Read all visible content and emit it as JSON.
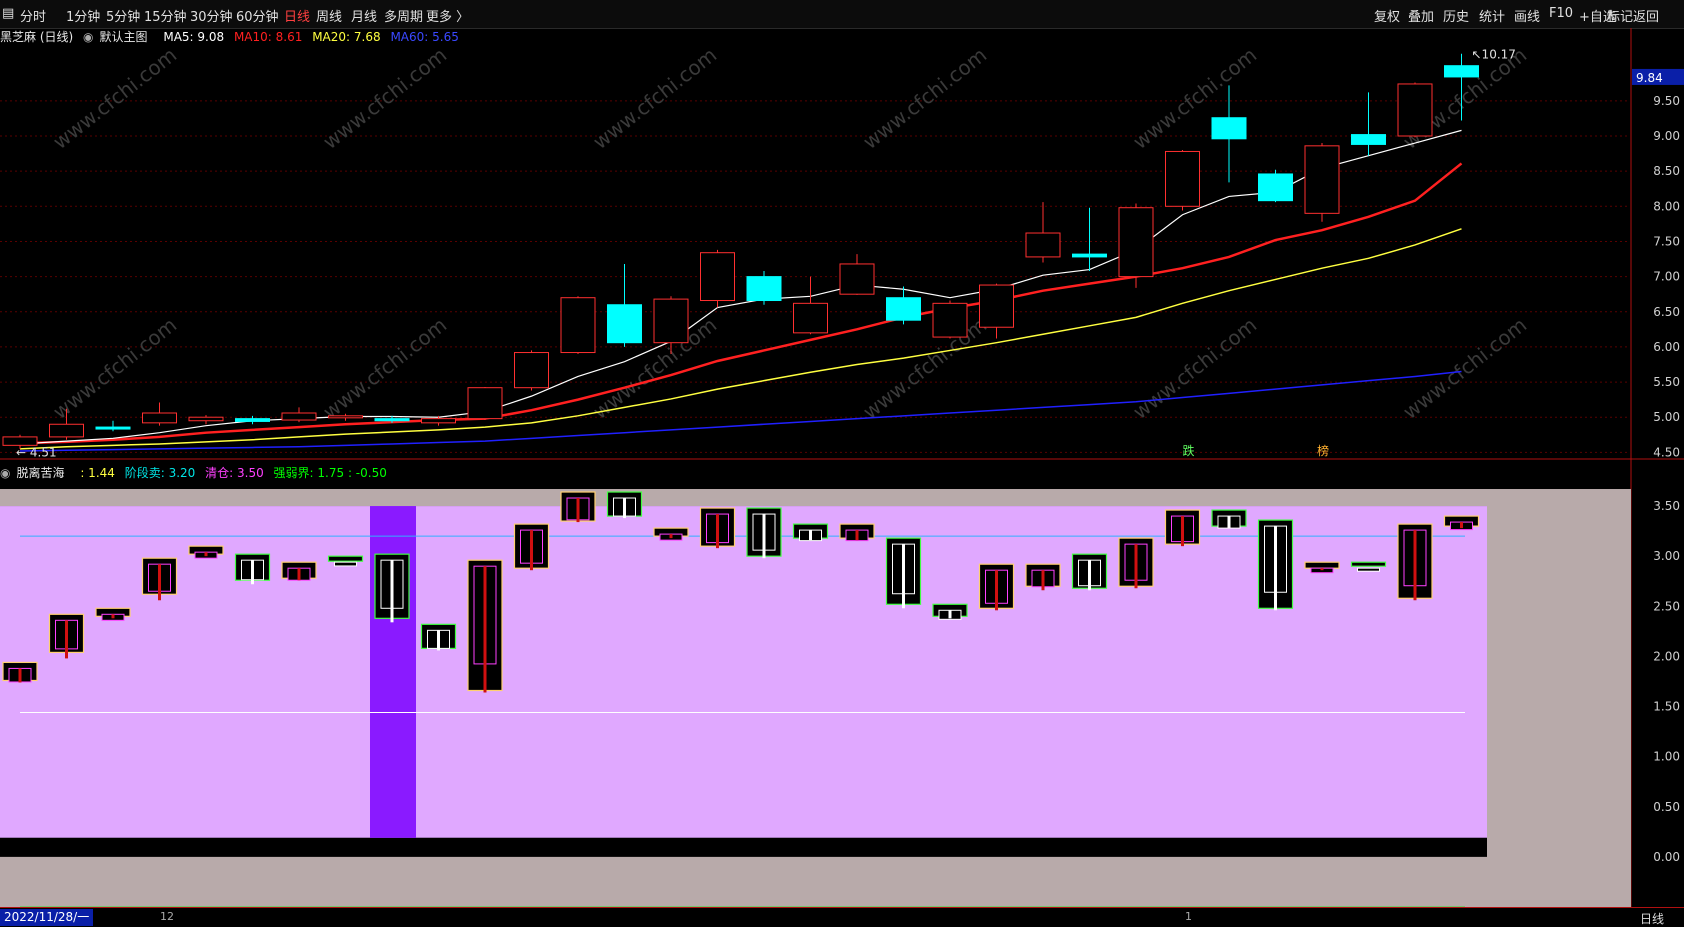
{
  "toolbar": {
    "left": [
      "分时",
      "1分钟",
      "5分钟",
      "15分钟",
      "30分钟",
      "60分钟",
      "日线",
      "周线",
      "月线",
      "多周期",
      "更多 〉"
    ],
    "active": "日线",
    "right": [
      "复权",
      "叠加",
      "历史",
      "统计",
      "画线",
      "F10",
      "+自选",
      "返回"
    ]
  },
  "main_header": {
    "stock": "黑芝麻 (日线)",
    "template": "默认主图",
    "ma5": "MA5: 9.08",
    "ma10": "MA10: 8.61",
    "ma20": "MA20: 7.68",
    "ma60": "MA60: 5.65"
  },
  "sub_header": {
    "name": "脱离苦海",
    "v1": ": 1.44",
    "v2": "阶段卖: 3.20",
    "v3": "清仓: 3.50",
    "v4": "强弱界: 1.75 : -0.50"
  },
  "markers": {
    "max_label": "10.17",
    "min_label": "4.51",
    "current_price": "9.84",
    "tag1": "跌",
    "tag2": "榜"
  },
  "status": {
    "date": "2022/11/28/一",
    "month1": "12",
    "month2": "1",
    "period": "日线"
  },
  "colors": {
    "up": "#ff3030",
    "down": "#00ffff",
    "ma5": "#ffffff",
    "ma10": "#ff2020",
    "ma20": "#ffff40",
    "ma60": "#2020ff",
    "sub_bg": "#e0a8ff",
    "sub_band": "#b8aaaa"
  },
  "watermark": "www.cfchi.com",
  "chart_data": {
    "type": "candlestick",
    "price_axis": [
      4.5,
      5.0,
      5.5,
      6.0,
      6.5,
      7.0,
      7.5,
      8.0,
      8.5,
      9.0,
      9.5
    ],
    "ind_axis": [
      0.0,
      0.5,
      1.0,
      1.5,
      2.0,
      2.5,
      3.0,
      3.5
    ],
    "candles": [
      [
        4.6,
        4.72,
        4.75,
        4.55
      ],
      [
        4.72,
        4.9,
        5.12,
        4.68
      ],
      [
        4.86,
        4.84,
        4.95,
        4.8
      ],
      [
        4.92,
        5.06,
        5.21,
        4.88
      ],
      [
        4.95,
        5.0,
        5.03,
        4.9
      ],
      [
        4.98,
        4.94,
        5.02,
        4.9
      ],
      [
        4.96,
        5.06,
        5.14,
        4.93
      ],
      [
        5.0,
        5.02,
        5.05,
        4.95
      ],
      [
        4.98,
        4.95,
        5.02,
        4.92
      ],
      [
        4.92,
        4.98,
        5.02,
        4.88
      ],
      [
        4.98,
        5.42,
        5.43,
        4.96
      ],
      [
        5.42,
        5.92,
        5.95,
        5.38
      ],
      [
        5.92,
        6.7,
        6.72,
        5.9
      ],
      [
        6.6,
        6.06,
        7.18,
        6.0
      ],
      [
        6.06,
        6.68,
        6.72,
        5.9
      ],
      [
        6.66,
        7.34,
        7.38,
        6.56
      ],
      [
        7.0,
        6.66,
        7.08,
        6.6
      ],
      [
        6.2,
        6.62,
        7.0,
        6.18
      ],
      [
        6.75,
        7.18,
        7.32,
        6.74
      ],
      [
        6.7,
        6.38,
        6.86,
        6.32
      ],
      [
        6.14,
        6.62,
        6.66,
        6.12
      ],
      [
        6.28,
        6.88,
        6.9,
        6.12
      ],
      [
        7.28,
        7.62,
        8.06,
        7.2
      ],
      [
        7.32,
        7.28,
        7.98,
        7.08
      ],
      [
        7.0,
        7.98,
        8.04,
        6.84
      ],
      [
        8.0,
        8.78,
        8.8,
        7.94
      ],
      [
        9.26,
        8.96,
        9.72,
        8.34
      ],
      [
        8.46,
        8.08,
        8.52,
        8.06
      ],
      [
        7.9,
        8.86,
        8.9,
        7.78
      ],
      [
        9.02,
        8.88,
        9.62,
        8.72
      ],
      [
        9.0,
        9.74,
        9.76,
        8.98
      ],
      [
        10.0,
        9.84,
        10.17,
        9.22
      ]
    ],
    "ma5": [
      4.62,
      4.66,
      4.7,
      4.78,
      4.88,
      4.95,
      4.98,
      5.01,
      5.01,
      5.0,
      5.08,
      5.3,
      5.58,
      5.79,
      6.08,
      6.56,
      6.68,
      6.72,
      6.88,
      6.82,
      6.7,
      6.82,
      7.02,
      7.1,
      7.38,
      7.88,
      8.14,
      8.2,
      8.54,
      8.72,
      8.9,
      9.08
    ],
    "ma10": [
      4.63,
      4.65,
      4.68,
      4.72,
      4.78,
      4.82,
      4.86,
      4.9,
      4.93,
      4.96,
      4.98,
      5.1,
      5.25,
      5.42,
      5.6,
      5.8,
      5.95,
      6.1,
      6.25,
      6.42,
      6.55,
      6.66,
      6.8,
      6.9,
      7.0,
      7.12,
      7.28,
      7.52,
      7.66,
      7.85,
      8.08,
      8.61
    ],
    "ma20": [
      4.55,
      4.58,
      4.6,
      4.62,
      4.65,
      4.68,
      4.72,
      4.76,
      4.79,
      4.82,
      4.86,
      4.92,
      5.02,
      5.14,
      5.26,
      5.4,
      5.52,
      5.64,
      5.75,
      5.84,
      5.95,
      6.06,
      6.18,
      6.3,
      6.42,
      6.62,
      6.8,
      6.96,
      7.12,
      7.26,
      7.45,
      7.68
    ],
    "ma60": [
      4.52,
      4.53,
      4.54,
      4.55,
      4.56,
      4.57,
      4.58,
      4.6,
      4.62,
      4.64,
      4.66,
      4.7,
      4.74,
      4.78,
      4.82,
      4.86,
      4.9,
      4.94,
      4.98,
      5.02,
      5.06,
      5.1,
      5.14,
      5.18,
      5.22,
      5.28,
      5.34,
      5.4,
      5.46,
      5.52,
      5.58,
      5.65
    ],
    "indicator": [
      [
        1.76,
        1.94,
        1.74,
        1.96,
        "y"
      ],
      [
        2.04,
        2.42,
        1.98,
        2.44,
        "y"
      ],
      [
        2.4,
        2.48,
        2.38,
        2.56,
        "y"
      ],
      [
        2.62,
        2.98,
        2.56,
        3.02,
        "y"
      ],
      [
        3.02,
        3.1,
        3.0,
        3.12,
        "y"
      ],
      [
        2.76,
        3.02,
        2.72,
        3.04,
        "g"
      ],
      [
        2.78,
        2.94,
        2.76,
        2.96,
        "y"
      ],
      [
        2.95,
        3.0,
        2.94,
        3.02,
        "g"
      ],
      [
        2.38,
        3.02,
        2.34,
        3.04,
        "g"
      ],
      [
        2.08,
        2.32,
        2.06,
        2.34,
        "g"
      ],
      [
        1.66,
        2.96,
        1.64,
        2.98,
        "y"
      ],
      [
        2.88,
        3.32,
        2.86,
        3.34,
        "y"
      ],
      [
        3.35,
        3.64,
        3.34,
        3.66,
        "y"
      ],
      [
        3.4,
        3.64,
        3.38,
        3.66,
        "g"
      ],
      [
        3.2,
        3.28,
        3.18,
        3.3,
        "y"
      ],
      [
        3.1,
        3.48,
        3.08,
        3.5,
        "y"
      ],
      [
        3.0,
        3.48,
        2.98,
        3.5,
        "g"
      ],
      [
        3.18,
        3.32,
        3.16,
        3.34,
        "g"
      ],
      [
        3.18,
        3.32,
        3.16,
        3.34,
        "y"
      ],
      [
        2.52,
        3.18,
        2.48,
        3.2,
        "g"
      ],
      [
        2.4,
        2.52,
        2.38,
        2.54,
        "g"
      ],
      [
        2.48,
        2.92,
        2.46,
        2.94,
        "y"
      ],
      [
        2.7,
        2.92,
        2.66,
        2.94,
        "y"
      ],
      [
        2.68,
        3.02,
        2.66,
        3.04,
        "g"
      ],
      [
        2.7,
        3.18,
        2.68,
        3.2,
        "y"
      ],
      [
        3.12,
        3.46,
        3.1,
        3.48,
        "y"
      ],
      [
        3.3,
        3.46,
        3.28,
        3.48,
        "g"
      ],
      [
        2.48,
        3.36,
        2.46,
        3.38,
        "g"
      ],
      [
        2.88,
        2.94,
        2.86,
        2.96,
        "y"
      ],
      [
        2.9,
        2.94,
        2.88,
        2.96,
        "g"
      ],
      [
        2.58,
        3.32,
        2.56,
        3.34,
        "y"
      ],
      [
        3.3,
        3.4,
        3.28,
        3.42,
        "y"
      ]
    ]
  }
}
